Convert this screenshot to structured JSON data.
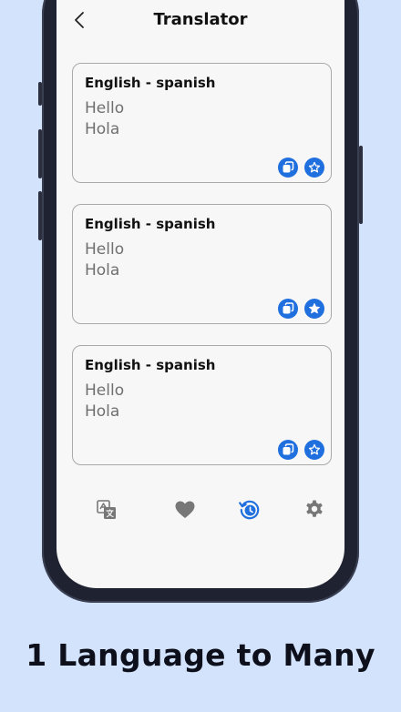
{
  "header": {
    "title": "Translator",
    "back_icon": "chevron-left-icon"
  },
  "cards": [
    {
      "language_pair": "English - spanish",
      "source_text": "Hello",
      "translated_text": "Hola",
      "favorite_state": "outline"
    },
    {
      "language_pair": "English - spanish",
      "source_text": "Hello",
      "translated_text": "Hola",
      "favorite_state": "filled"
    },
    {
      "language_pair": "English - spanish",
      "source_text": "Hello",
      "translated_text": "Hola",
      "favorite_state": "outline"
    }
  ],
  "bottom_nav": {
    "items": [
      {
        "icon": "translate-icon",
        "active": false
      },
      {
        "icon": "heart-icon",
        "active": false
      },
      {
        "icon": "history-icon",
        "active": true
      },
      {
        "icon": "gear-icon",
        "active": false
      }
    ]
  },
  "caption": "1 Language to Many",
  "colors": {
    "accent": "#1f6fde",
    "background": "#d3e3fb",
    "nav_inactive": "#777777"
  }
}
